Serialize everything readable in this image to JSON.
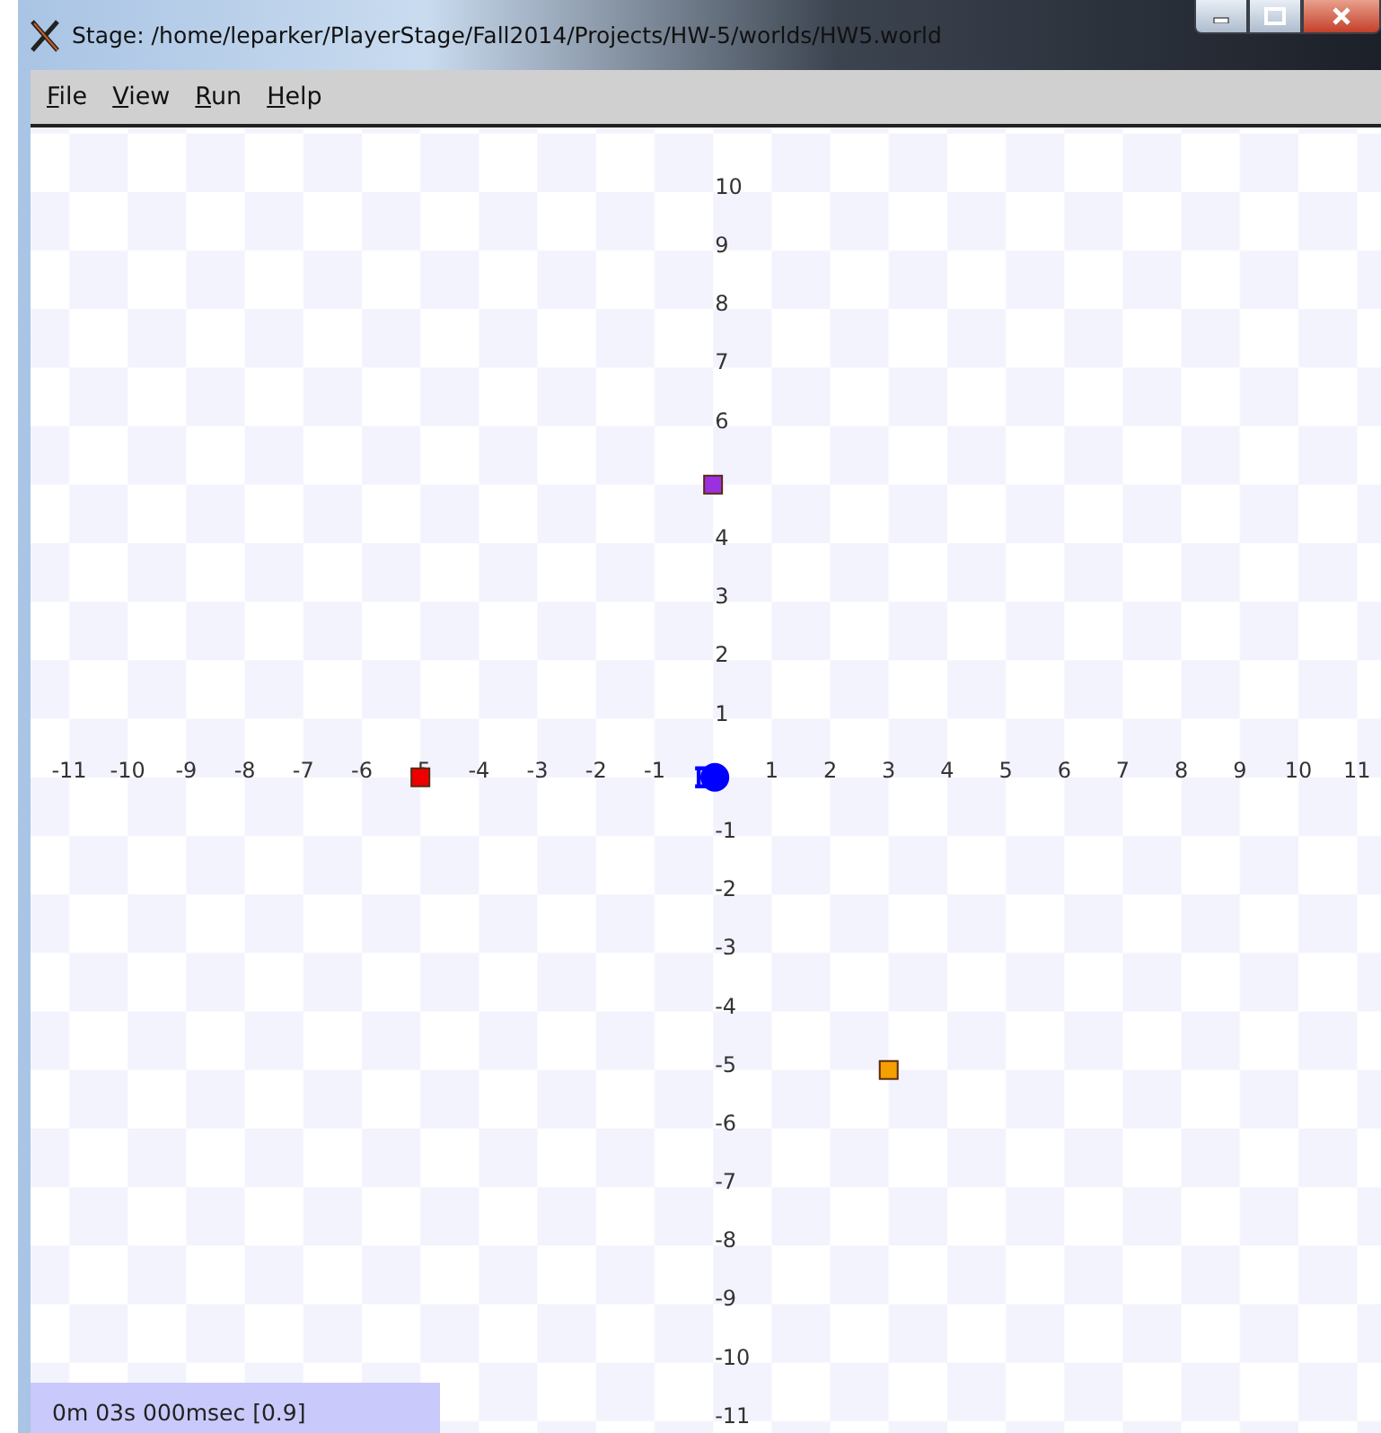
{
  "window": {
    "title": "Stage: /home/leparker/PlayerStage/Fall2014/Projects/HW-5/worlds/HW5.world"
  },
  "menu": [
    "File",
    "View",
    "Run",
    "Help"
  ],
  "world": {
    "chart_data": {
      "type": "scatter",
      "xticks": [
        -11,
        -10,
        -9,
        -8,
        -7,
        -6,
        -5,
        -4,
        -3,
        -2,
        -1,
        1,
        2,
        3,
        4,
        5,
        6,
        7,
        8,
        9,
        10,
        11
      ],
      "xlim": [
        -11.66,
        11.41
      ],
      "ylim": [
        -11.2,
        11.1
      ],
      "yticks": [
        -11,
        -10,
        -9,
        -8,
        -7,
        -6,
        -5,
        -4,
        -3,
        -2,
        -1,
        1,
        2,
        3,
        4,
        6,
        7,
        8,
        9,
        10
      ],
      "series": [
        {
          "marker": "square",
          "color": "#ee0000",
          "x": [
            -5
          ],
          "values": [
            0
          ]
        },
        {
          "marker": "square",
          "color": "#9b30e0",
          "x": [
            0
          ],
          "values": [
            5
          ]
        },
        {
          "marker": "square",
          "color": "#f5a000",
          "x": [
            3
          ],
          "values": [
            -5
          ]
        },
        {
          "marker": "circle",
          "color": "#0000ff",
          "x": [
            0
          ],
          "values": [
            0
          ]
        }
      ]
    }
  },
  "status_bar": "0m 03s 000msec [0.9]"
}
